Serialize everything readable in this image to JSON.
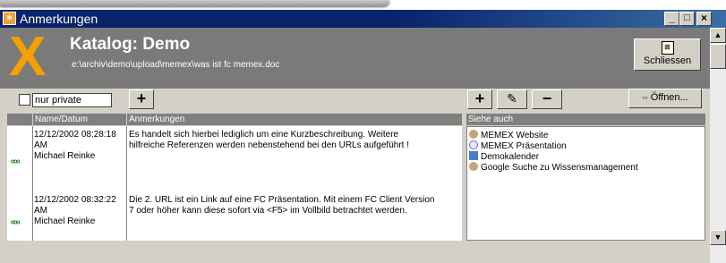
{
  "window": {
    "title": "Anmerkungen",
    "minimize": "_",
    "maximize": "□",
    "close": "×"
  },
  "header": {
    "title": "Katalog: Demo",
    "path": "e:\\archiv\\demo\\upload\\memex\\was ist fc memex.doc",
    "logo": "X",
    "close_button": "Schliessen"
  },
  "left": {
    "private_label": "nur private",
    "add_label": "+",
    "col_name": "Name/Datum",
    "col_notes": "Anmerkungen",
    "rows": [
      {
        "date": "12/12/2002 08:28:18",
        "ampm": "AM",
        "author": "Michael Reinke",
        "note_line1": "Es handelt sich hierbei lediglich um eine Kurzbeschreibung. Weitere",
        "note_line2": "hilfreiche Referenzen werden nebenstehend bei den URLs aufgeführt !"
      },
      {
        "date": "12/12/2002 08:32:22",
        "ampm": "AM",
        "author": "Michael Reinke",
        "note_line1": "Die 2. URL ist ein Link auf eine FC Präsentation. Mit einem FC Client Version",
        "note_line2": "7 oder höher kann diese sofort via <F5> im Vollbild betrachtet werden."
      }
    ]
  },
  "right": {
    "add_label": "+",
    "remove_label": "−",
    "open_label": "Öffnen...",
    "col_see_also": "Siehe auch",
    "items": [
      {
        "label": "MEMEX Website",
        "icon": "globe-search-icon"
      },
      {
        "label": "MEMEX Präsentation",
        "icon": "presentation-icon"
      },
      {
        "label": "Demokalender",
        "icon": "calendar-people-icon"
      },
      {
        "label": "Google Suche zu Wissensmanagement",
        "icon": "globe-search-icon"
      }
    ]
  },
  "colors": {
    "titlebar": "#0a246a",
    "header": "#7a7a7a",
    "logo": "#f5a000",
    "face": "#d4d0c8"
  }
}
